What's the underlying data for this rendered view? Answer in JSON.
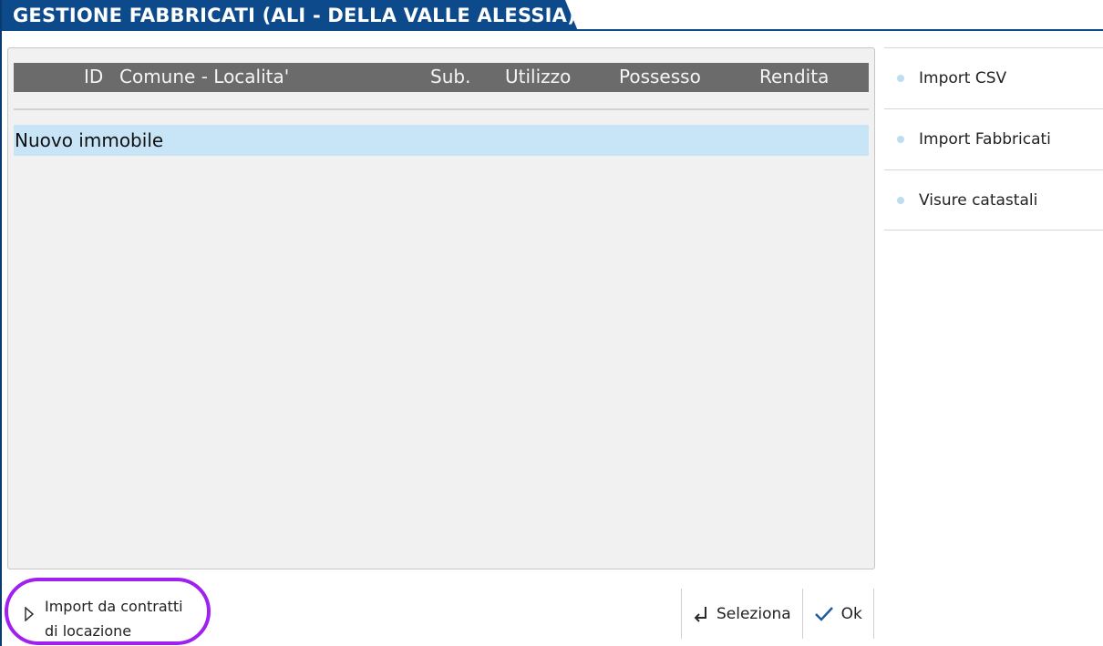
{
  "window": {
    "title": "GESTIONE FABBRICATI (ALI - DELLA VALLE ALESSIA)"
  },
  "table": {
    "columns": [
      "ID",
      "Comune - Localita'",
      "Sub.",
      "Utilizzo",
      "Possesso",
      "Rendita"
    ],
    "rows": [
      {
        "label": "Nuovo immobile"
      }
    ]
  },
  "side_menu": {
    "items": [
      {
        "label": "Import CSV"
      },
      {
        "label": "Import Fabbricati"
      },
      {
        "label": "Visure catastali"
      }
    ]
  },
  "footer": {
    "import_line1": "Import da contratti",
    "import_line2": "di locazione",
    "seleziona_label": "Seleziona",
    "ok_label": "Ok"
  },
  "colors": {
    "title_bar": "#0d4a8b",
    "header_bg": "#6b6b6b",
    "selected_row": "#c8e4f7",
    "highlight_ring": "#a020f0"
  }
}
